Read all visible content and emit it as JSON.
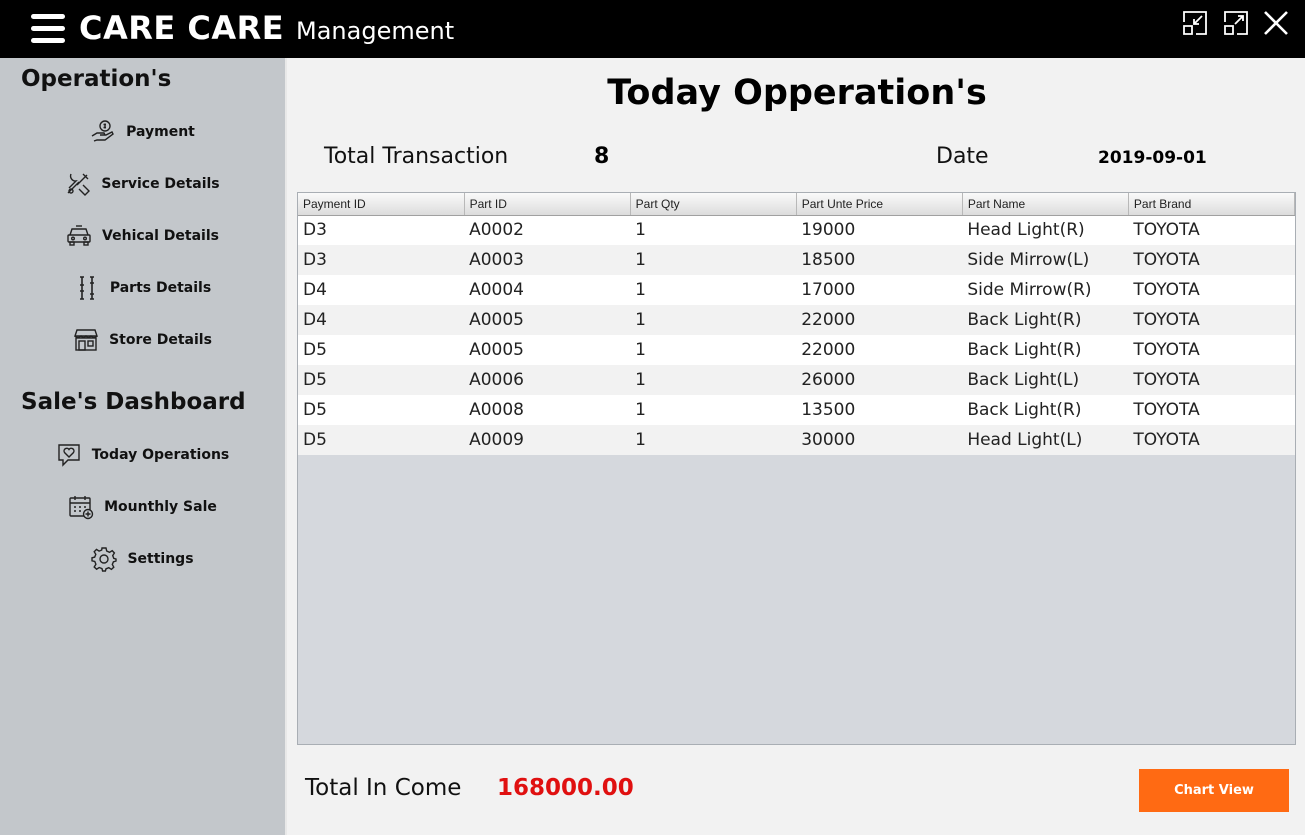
{
  "app": {
    "brand": "CARE CARE",
    "subtitle": "Management"
  },
  "window_controls": {
    "minimize_icon": "minimize-icon",
    "maximize_icon": "maximize-icon",
    "close_icon": "close-icon"
  },
  "sidebar": {
    "operations_heading": "Operation's",
    "operations": [
      {
        "label": "Payment",
        "icon": "payment-hand-icon"
      },
      {
        "label": "Service Details",
        "icon": "tools-icon"
      },
      {
        "label": "Vehical Details",
        "icon": "car-icon"
      },
      {
        "label": "Parts Details",
        "icon": "parts-icon"
      },
      {
        "label": "Store Details",
        "icon": "store-icon"
      }
    ],
    "dashboard_heading": "Sale's Dashboard",
    "dashboard": [
      {
        "label": "Today Operations",
        "icon": "heart-chat-icon"
      },
      {
        "label": "Mounthly Sale",
        "icon": "calendar-icon"
      },
      {
        "label": "Settings",
        "icon": "gear-icon"
      }
    ]
  },
  "main": {
    "title": "Today Opperation's",
    "total_transaction_label": "Total Transaction",
    "total_transaction_value": "8",
    "date_label": "Date",
    "date_value": "2019-09-01",
    "table": {
      "headers": [
        "Payment ID",
        "Part ID",
        "Part Qty",
        "Part Unte Price",
        "Part Name",
        "Part Brand"
      ],
      "rows": [
        [
          "D3",
          "A0002",
          "1",
          "19000",
          "Head Light(R)",
          "TOYOTA"
        ],
        [
          "D3",
          "A0003",
          "1",
          "18500",
          "Side Mirrow(L)",
          "TOYOTA"
        ],
        [
          "D4",
          "A0004",
          "1",
          "17000",
          "Side Mirrow(R)",
          "TOYOTA"
        ],
        [
          "D4",
          "A0005",
          "1",
          "22000",
          "Back Light(R)",
          "TOYOTA"
        ],
        [
          "D5",
          "A0005",
          "1",
          "22000",
          "Back Light(R)",
          "TOYOTA"
        ],
        [
          "D5",
          "A0006",
          "1",
          "26000",
          "Back Light(L)",
          "TOYOTA"
        ],
        [
          "D5",
          "A0008",
          "1",
          "13500",
          "Back Light(R)",
          "TOYOTA"
        ],
        [
          "D5",
          "A0009",
          "1",
          "30000",
          "Head Light(L)",
          "TOYOTA"
        ]
      ]
    },
    "total_income_label": "Total In Come",
    "total_income_value": "168000.00",
    "chart_button_label": "Chart View"
  },
  "colors": {
    "titlebar": "#000000",
    "sidebar": "#c3c7cb",
    "income": "#e01010",
    "button": "#ff6a13"
  }
}
